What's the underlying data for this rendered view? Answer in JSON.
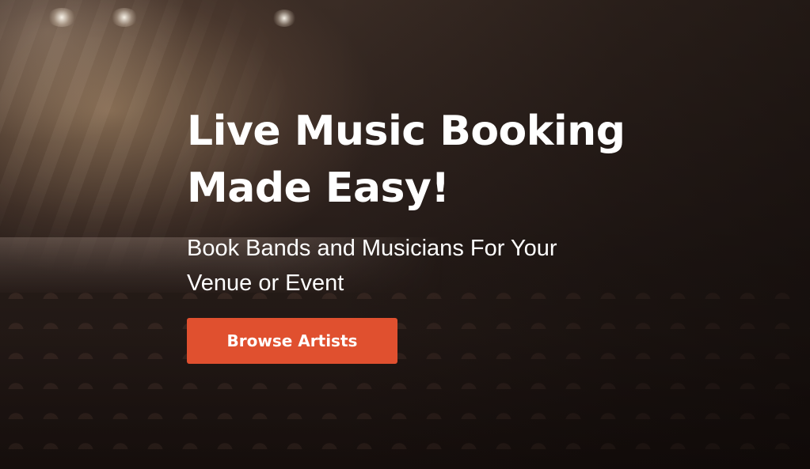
{
  "hero": {
    "title_line1": "Live Music Booking",
    "title_line2": "Made Easy!",
    "subtitle_line1": "Book Bands and Musicians For Your",
    "subtitle_line2": "Venue or Event",
    "cta_label": "Browse Artists"
  },
  "colors": {
    "cta_background": "#e0502f",
    "text": "#ffffff"
  }
}
